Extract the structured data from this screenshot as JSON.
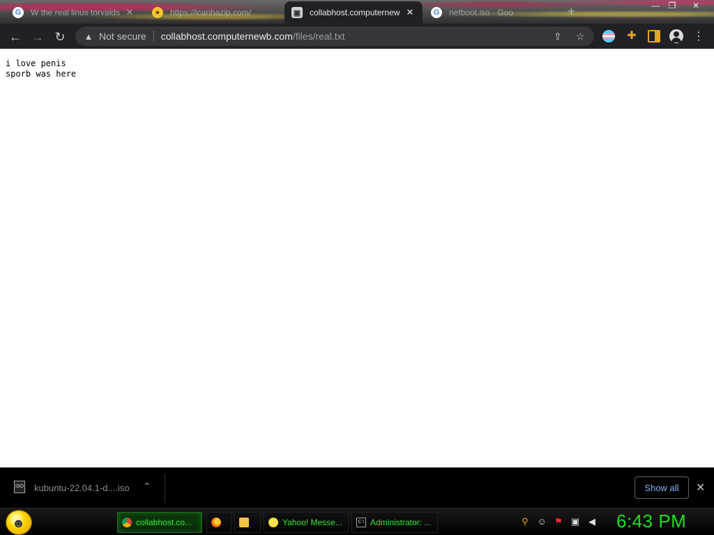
{
  "tabs": [
    {
      "title": "W the real linus torvalds",
      "favicon": "google-icon",
      "active": false
    },
    {
      "title": "https://icanhazip.com/",
      "favicon": "globe-icon",
      "active": false
    },
    {
      "title": "collabhost.computernewb.com/files/real.txt",
      "favicon": "page-icon",
      "active": true
    },
    {
      "title": "netboot.iso - Goo",
      "favicon": "google-icon",
      "active": false
    }
  ],
  "toolbar": {
    "security_label": "Not secure",
    "url_host": "collabhost.computernewb.com",
    "url_path": "/files/real.txt"
  },
  "page": {
    "lines": [
      "i love penis",
      "sporb was here"
    ]
  },
  "downloads": {
    "file_name": "kubuntu-22.04.1-d....iso",
    "file_icon_label": "ISO",
    "show_all_label": "Show all"
  },
  "taskbar": {
    "items": [
      {
        "label": "collabhost.co...",
        "icon": "chrome-icon",
        "active": true
      },
      {
        "label": "",
        "icon": "firefox-icon",
        "active": false
      },
      {
        "label": "",
        "icon": "folder-icon",
        "active": false
      },
      {
        "label": "Yahoo! Messe...",
        "icon": "yahoo-messenger-icon",
        "active": false
      },
      {
        "label": "Administrator: ...",
        "icon": "cmd-icon",
        "active": false
      }
    ],
    "clock": "6:43 PM"
  },
  "colors": {
    "chrome_dark": "#202124",
    "omnibox": "#35363a",
    "taskbar_green": "#1fe01f",
    "link_blue": "#8ab4f8"
  }
}
